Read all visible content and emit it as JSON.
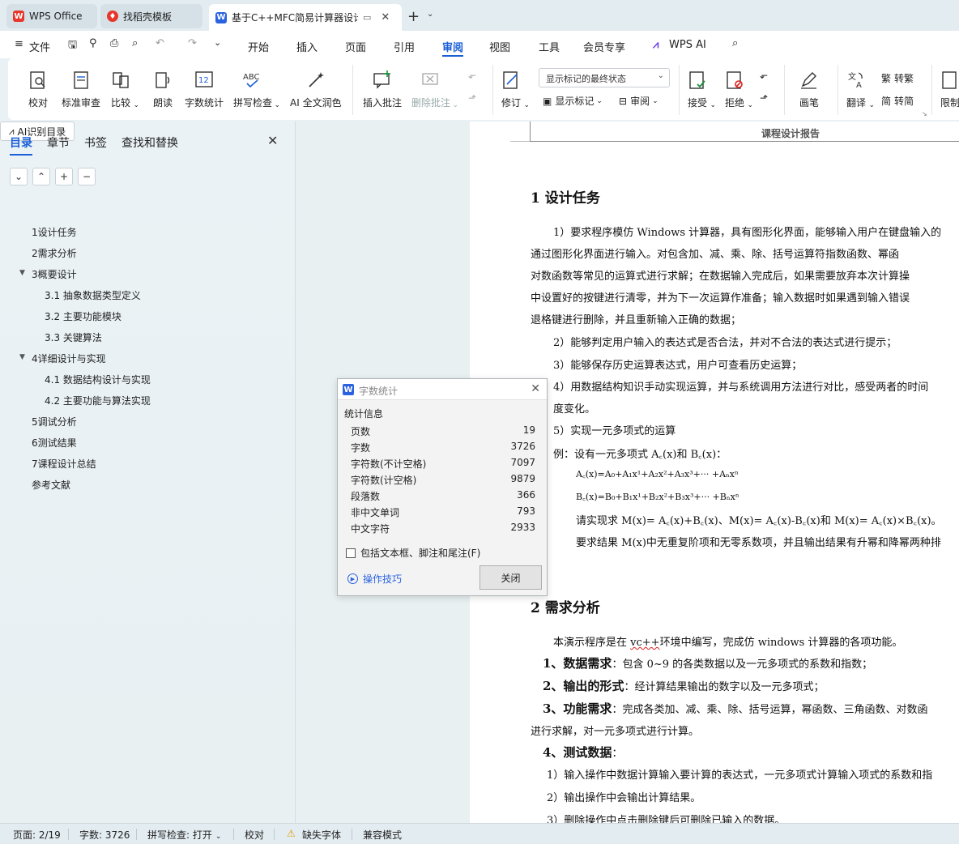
{
  "tabs": [
    {
      "label": "WPS Office",
      "icon": "wps-logo-icon",
      "color": "#e8362b"
    },
    {
      "label": "找稻壳模板",
      "icon": "docer-icon",
      "color": "#e8362b"
    },
    {
      "label": "基于C++MFC简易计算器设计",
      "icon": "word-icon",
      "color": "#2a62e0"
    }
  ],
  "menu": {
    "file": "文件",
    "items": [
      "开始",
      "插入",
      "页面",
      "引用",
      "审阅",
      "视图",
      "工具",
      "会员专享"
    ],
    "active": "审阅",
    "wps_ai": "WPS AI"
  },
  "ribbon": {
    "proofread": "校对",
    "std_review": "标准审查",
    "compare": "比较",
    "read_aloud": "朗读",
    "word_count": "字数统计",
    "spell_check": "拼写检查",
    "ai_polish": "AI 全文润色",
    "insert_comment": "插入批注",
    "delete_comment": "删除批注",
    "revise": "修订",
    "display_mode": "显示标记的最终状态",
    "show_markup": "显示标记",
    "review_pane": "审阅",
    "accept": "接受",
    "reject": "拒绝",
    "pen": "画笔",
    "translate": "翻译",
    "to_traditional": "转繁",
    "to_simplified": "转简",
    "restrict": "限制"
  },
  "panel": {
    "tabs": [
      "目录",
      "章节",
      "书签",
      "查找和替换"
    ],
    "ai_toc": "AI识别目录",
    "toc": [
      {
        "label": "1设计任务",
        "level": 1
      },
      {
        "label": "2需求分析",
        "level": 1
      },
      {
        "label": "3概要设计",
        "level": 1,
        "expanded": true
      },
      {
        "label": "3.1 抽象数据类型定义",
        "level": 2
      },
      {
        "label": "3.2  主要功能模块",
        "level": 2
      },
      {
        "label": "3.3  关键算法",
        "level": 2
      },
      {
        "label": "4详细设计与实现",
        "level": 1,
        "expanded": true
      },
      {
        "label": "4.1  数据结构设计与实现",
        "level": 2
      },
      {
        "label": "4.2  主要功能与算法实现",
        "level": 2
      },
      {
        "label": "5调试分析",
        "level": 1
      },
      {
        "label": "6测试结果",
        "level": 1
      },
      {
        "label": "7课程设计总结",
        "level": 1
      },
      {
        "label": "参考文献",
        "level": 1
      }
    ]
  },
  "doc": {
    "header": "课程设计报告",
    "h1": "1   设计任务",
    "p1": [
      "1）要求程序模仿 Windows 计算器，具有图形化界面，能够输入用户在键盘输入的",
      "通过图形化界面进行输入。对包含加、减、乘、除、括号运算符指数函数、幂函",
      "对数函数等常见的运算式进行求解；在数据输入完成后，如果需要放弃本次计算操",
      "中设置好的按键进行清零，并为下一次运算作准备；输入数据时如果遇到输入错误",
      "退格键进行删除，并且重新输入正确的数据；"
    ],
    "p2": "2）能够判定用户输入的表达式是否合法，并对不合法的表达式进行提示；",
    "p3": "3）能够保存历史运算表达式，用户可查看历史运算；",
    "p4a": "4）用数据结构知识手动实现运算，并与系统调用方法进行对比，感受两者的时间",
    "p4b": "度变化。",
    "p5": "5）实现一元多项式的运算",
    "ex": "例：设有一元多项式 A꜀(x)和 B꜀(x)：",
    "fa": "A꜀(x)=A₀+A₁x¹+A₂x²+A₃x³+···  +Aₙxⁿ",
    "fb": "B꜀(x)=B₀+B₁x¹+B₂x²+B₃x³+···  +Bₙxⁿ",
    "req": "请实现求 M(x)= A꜀(x)+B꜀(x)、M(x)= A꜀(x)-B꜀(x)和 M(x)= A꜀(x)×B꜀(x)。",
    "req2": "要求结果 M(x)中无重复阶项和无零系数项，并且输出结果有升幂和降幂两种排",
    "h2": "2   需求分析",
    "intro_pre": "本演示程序是在 ",
    "intro_vc": "vc++",
    "intro_post": "环境中编写，完成仿 windows 计算器的各项功能。",
    "n1_b": "1、数据需求",
    "n1": "：包含 0~9 的各类数据以及一元多项式的系数和指数；",
    "n2_b": "2、输出的形式",
    "n2": "：经计算结果输出的数字以及一元多项式；",
    "n3_b": "3、功能需求",
    "n3": "：完成各类加、减、乘、除、括号运算，幂函数、三角函数、对数函",
    "n3b": "进行求解，对一元多项式进行计算。",
    "n4_b": "4、测试数据",
    "n4": "：",
    "t1": "1）输入操作中数据计算输入要计算的表达式，一元多项式计算输入项式的系数和指",
    "t2": "2）输出操作中会输出计算结果。",
    "t3": "3）删除操作中点击删除键后可删除已输入的数据。"
  },
  "dialog": {
    "title": "字数统计",
    "section": "统计信息",
    "stats": [
      {
        "label": "页数",
        "value": "19"
      },
      {
        "label": "字数",
        "value": "3726"
      },
      {
        "label": "字符数(不计空格)",
        "value": "7097"
      },
      {
        "label": "字符数(计空格)",
        "value": "9879"
      },
      {
        "label": "段落数",
        "value": "366"
      },
      {
        "label": "非中文单词",
        "value": "793"
      },
      {
        "label": "中文字符",
        "value": "2933"
      }
    ],
    "include_label": "包括文本框、脚注和尾注(F)",
    "tips": "操作技巧",
    "close": "关闭"
  },
  "status": {
    "page": "页面: 2/19",
    "words": "字数: 3726",
    "spell": "拼写检查: 打开",
    "proof": "校对",
    "missing_font": "缺失字体",
    "compat": "兼容模式"
  },
  "colors": {
    "accent": "#1a5fd6",
    "wps_red": "#e8362b"
  }
}
